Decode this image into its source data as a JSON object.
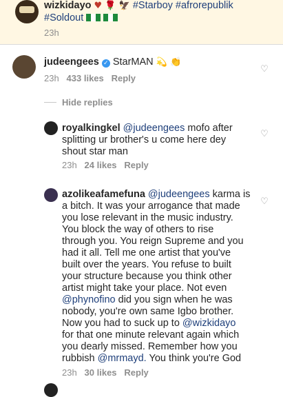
{
  "caption": {
    "username": "wizkidayo",
    "emojis": "♥ 🌹 🦅",
    "hashtags_line1": "#Starboy #afrorepublik",
    "hashtags_line2": "#Soldout",
    "time": "23h",
    "avatar_text": "STARBOY"
  },
  "comments": [
    {
      "username": "judeengees",
      "verified": true,
      "text": "StarMAN",
      "emojis": "💫 👏",
      "time": "23h",
      "likes": "433 likes",
      "reply": "Reply"
    }
  ],
  "hide_replies": "Hide replies",
  "replies": [
    {
      "username": "royalkingkel",
      "lines": [
        "@judeengees mofo after",
        "splitting ur brother's u come here dey",
        "shout star man"
      ],
      "mention": "@judeengees",
      "time": "23h",
      "likes": "24 likes",
      "reply": "Reply"
    },
    {
      "username": "azolikeafamefuna",
      "lines": [
        "@judeengees karma is",
        "a bitch. It was your arrogance that made",
        "you lose relevant in the music industry.",
        "You block the way of others to rise",
        "through you. You reign Supreme and you",
        "had it all. Tell me one artist that you've",
        "built over the years. You refuse to built",
        "your structure because you think other",
        "artist might take your place. Not even",
        "@phynofino did you sign when he was",
        "nobody, you're own same Igbo brother.",
        "Now you had to suck up to @wizkidayo",
        "for that one minute relevant again which",
        "you dearly missed. Remember how you",
        "rubbish @mrmayd. You think you're God"
      ],
      "time": "23h",
      "likes": "30 likes",
      "reply": "Reply"
    }
  ],
  "colors": {
    "caption_bg": "#fff7e3",
    "mention": "#1e3f7a",
    "meta": "#8e8e8e",
    "verified": "#3897f0"
  },
  "icons": {
    "like": "heart-outline-icon",
    "verified": "verified-badge-icon"
  }
}
